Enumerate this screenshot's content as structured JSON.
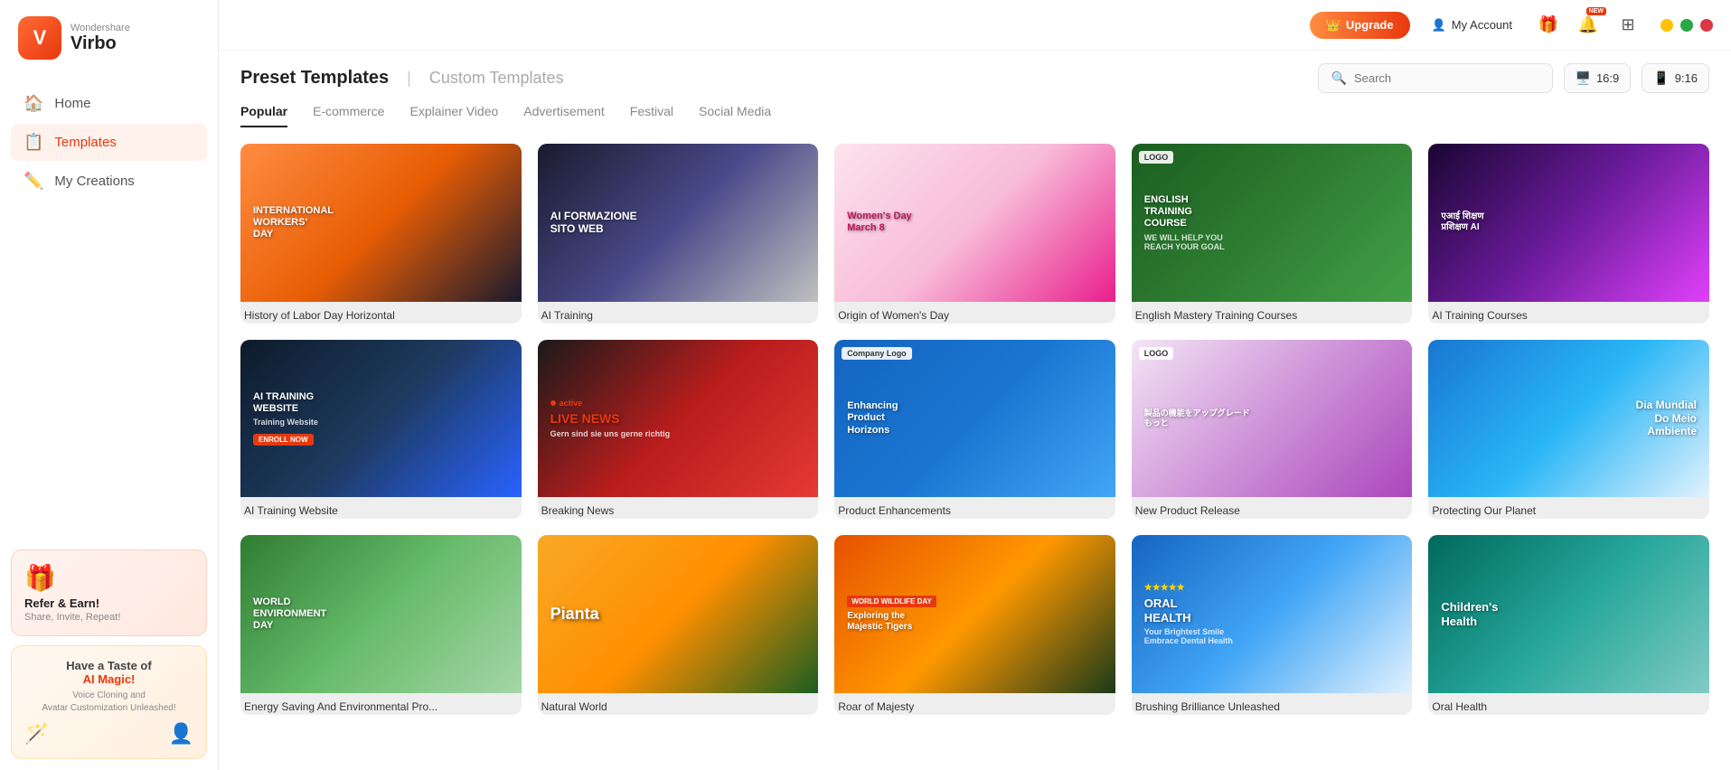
{
  "app": {
    "name": "Virbo",
    "brand": "Wondershare",
    "logo_letter": "V"
  },
  "topbar": {
    "upgrade_label": "Upgrade",
    "my_account_label": "My Account",
    "aspect_ratio_16_9": "16:9",
    "aspect_ratio_9_16": "9:16"
  },
  "sidebar": {
    "items": [
      {
        "id": "home",
        "label": "Home",
        "icon": "🏠",
        "active": false
      },
      {
        "id": "templates",
        "label": "Templates",
        "icon": "📋",
        "active": true
      },
      {
        "id": "my-creations",
        "label": "My Creations",
        "icon": "✏️",
        "active": false
      }
    ],
    "promo_refer": {
      "title": "Refer & Earn!",
      "subtitle": "Share, Invite, Repeat!"
    },
    "promo_ai": {
      "pre": "Have a Taste of",
      "highlight": "AI Magic!",
      "sub": "Voice Cloning and\nAvatar Customization Unleashed!"
    }
  },
  "content": {
    "preset_title": "Preset Templates",
    "custom_title": "Custom Templates",
    "filter_tabs": [
      {
        "id": "popular",
        "label": "Popular",
        "active": true
      },
      {
        "id": "ecommerce",
        "label": "E-commerce",
        "active": false
      },
      {
        "id": "explainer",
        "label": "Explainer Video",
        "active": false
      },
      {
        "id": "advertisement",
        "label": "Advertisement",
        "active": false
      },
      {
        "id": "festival",
        "label": "Festival",
        "active": false
      },
      {
        "id": "social",
        "label": "Social Media",
        "active": false
      }
    ],
    "search_placeholder": "Search",
    "templates": [
      {
        "id": "labor-day",
        "label": "History of Labor Day Horizontal",
        "theme": "card-labor",
        "heading": "INTERNATIONAL WORKERS' DAY",
        "badge": ""
      },
      {
        "id": "ai-training",
        "label": "AI Training",
        "theme": "card-ai-training",
        "heading": "AI FORMAZIONE SITO WEB",
        "badge": ""
      },
      {
        "id": "womens-day",
        "label": "Origin of Women's Day",
        "theme": "card-womens",
        "heading": "Women's Day March 8",
        "badge": ""
      },
      {
        "id": "english-course",
        "label": "English Mastery Training Courses",
        "theme": "card-english",
        "heading": "ENGLISH TRAINING COURSE",
        "badge": ""
      },
      {
        "id": "ai-courses",
        "label": "AI Training Courses",
        "theme": "card-ai-courses",
        "heading": "एआई शिक्षण प्रशिक्षण AI",
        "badge": ""
      },
      {
        "id": "ai-website",
        "label": "AI Training Website",
        "theme": "card-ai-website",
        "heading": "AI TRAINING WEBSITE",
        "badge": ""
      },
      {
        "id": "breaking-news",
        "label": "Breaking News",
        "theme": "card-breaking",
        "heading": "LIVE NEWS",
        "badge": ""
      },
      {
        "id": "product-enh",
        "label": "Product Enhancements",
        "theme": "card-product-enh",
        "heading": "Enhancing Product Horizons",
        "badge": ""
      },
      {
        "id": "new-product",
        "label": "New Product Release",
        "theme": "card-new-product",
        "heading": "製品をアップグレード",
        "badge": ""
      },
      {
        "id": "planet",
        "label": "Protecting Our Planet",
        "theme": "card-planet",
        "heading": "Dia Mundial Do Meio Ambiente",
        "badge": ""
      },
      {
        "id": "environment",
        "label": "Energy Saving And Environmental Pro...",
        "theme": "card-environment",
        "heading": "WORLD ENVIRONMENT DAY",
        "badge": ""
      },
      {
        "id": "natural",
        "label": "Natural World",
        "theme": "card-natural",
        "heading": "Pianta",
        "badge": ""
      },
      {
        "id": "roar",
        "label": "Roar of Majesty",
        "theme": "card-roar",
        "heading": "Exploring the Majestic Tigers",
        "badge": ""
      },
      {
        "id": "oral",
        "label": "Brushing Brilliance Unleashed",
        "theme": "card-oral",
        "heading": "ORAL HEALTH",
        "badge": ""
      },
      {
        "id": "children",
        "label": "Oral Health",
        "theme": "card-children",
        "heading": "Children's Health",
        "badge": ""
      }
    ]
  },
  "colors": {
    "accent": "#e8380d",
    "active_nav_bg": "#fff1ec",
    "active_tab_color": "#222222"
  }
}
